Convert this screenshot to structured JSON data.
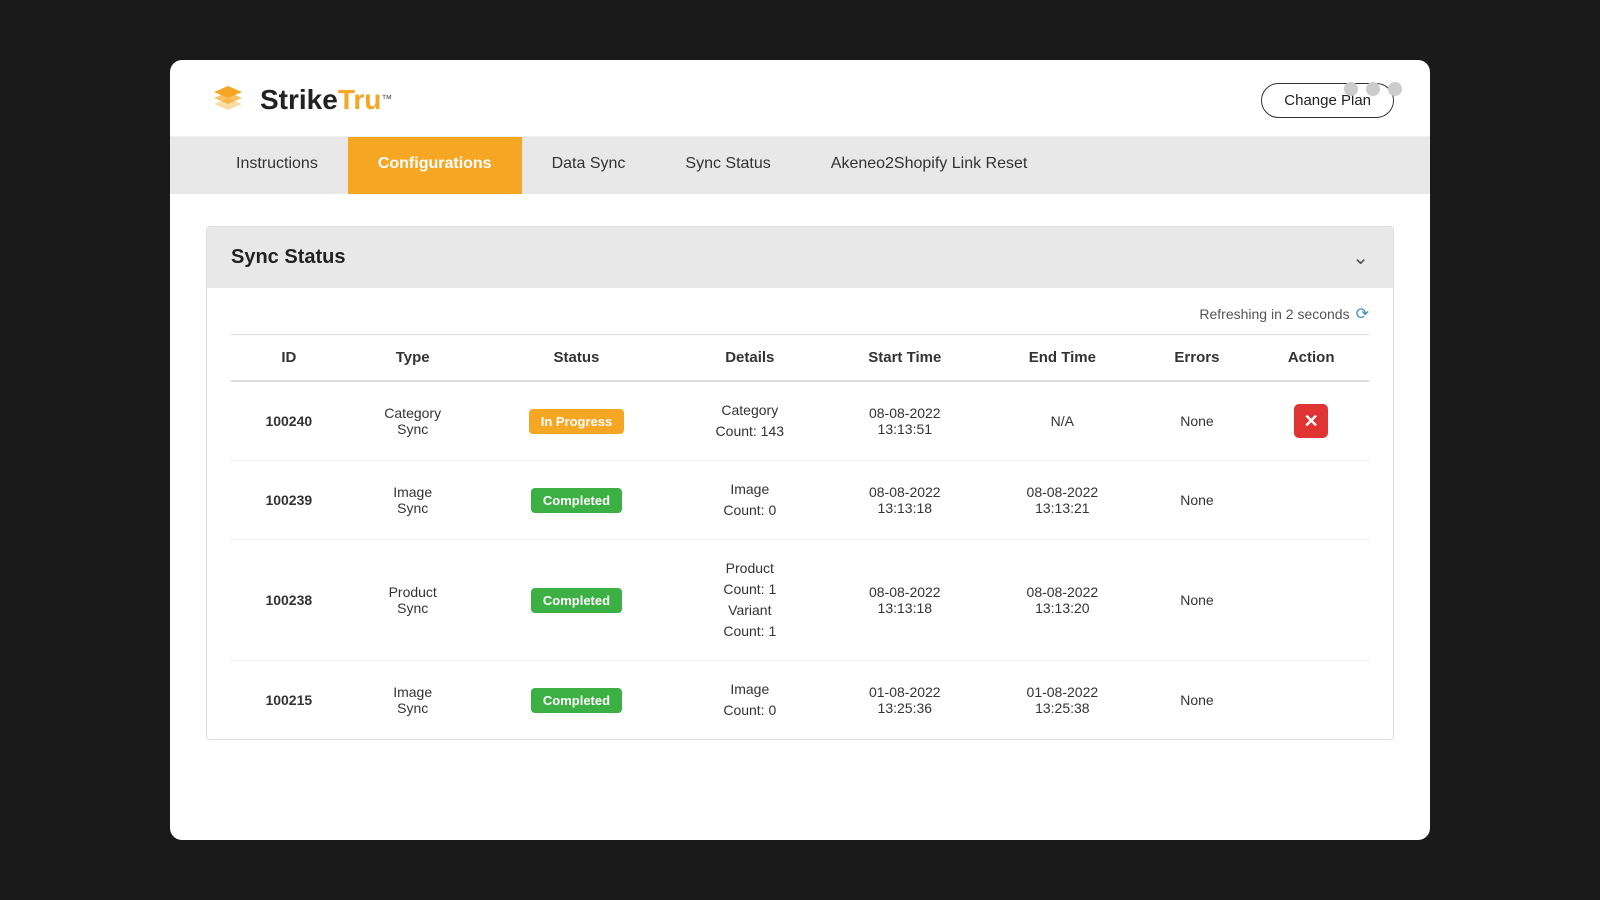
{
  "window": {
    "title": "StrikeTru"
  },
  "header": {
    "logo_text_strike": "Strike",
    "logo_text_tru": "Tru",
    "logo_tm": "™",
    "change_plan_label": "Change Plan"
  },
  "nav": {
    "items": [
      {
        "id": "instructions",
        "label": "Instructions",
        "active": false
      },
      {
        "id": "configurations",
        "label": "Configurations",
        "active": true
      },
      {
        "id": "data-sync",
        "label": "Data Sync",
        "active": false
      },
      {
        "id": "sync-status",
        "label": "Sync Status",
        "active": false
      },
      {
        "id": "akeneo-link-reset",
        "label": "Akeneo2Shopify Link Reset",
        "active": false
      }
    ]
  },
  "sync_status_section": {
    "title": "Sync Status",
    "refresh_text": "Refreshing in 2 seconds",
    "table": {
      "headers": [
        "ID",
        "Type",
        "Status",
        "Details",
        "Start Time",
        "End Time",
        "Errors",
        "Action"
      ],
      "rows": [
        {
          "id": "100240",
          "type": "Category\nSync",
          "status": "In Progress",
          "status_type": "in-progress",
          "details": "Category\nCount: 143",
          "start_time": "08-08-2022\n13:13:51",
          "end_time": "N/A",
          "errors": "None",
          "has_action": true
        },
        {
          "id": "100239",
          "type": "Image\nSync",
          "status": "Completed",
          "status_type": "completed",
          "details": "Image\nCount: 0",
          "start_time": "08-08-2022\n13:13:18",
          "end_time": "08-08-2022\n13:13:21",
          "errors": "None",
          "has_action": false
        },
        {
          "id": "100238",
          "type": "Product\nSync",
          "status": "Completed",
          "status_type": "completed",
          "details": "Product\nCount: 1\nVariant\nCount: 1",
          "start_time": "08-08-2022\n13:13:18",
          "end_time": "08-08-2022\n13:13:20",
          "errors": "None",
          "has_action": false
        },
        {
          "id": "100215",
          "type": "Image\nSync",
          "status": "Completed",
          "status_type": "completed",
          "details": "Image\nCount: 0",
          "start_time": "01-08-2022\n13:25:36",
          "end_time": "01-08-2022\n13:25:38",
          "errors": "None",
          "has_action": false
        }
      ]
    }
  }
}
